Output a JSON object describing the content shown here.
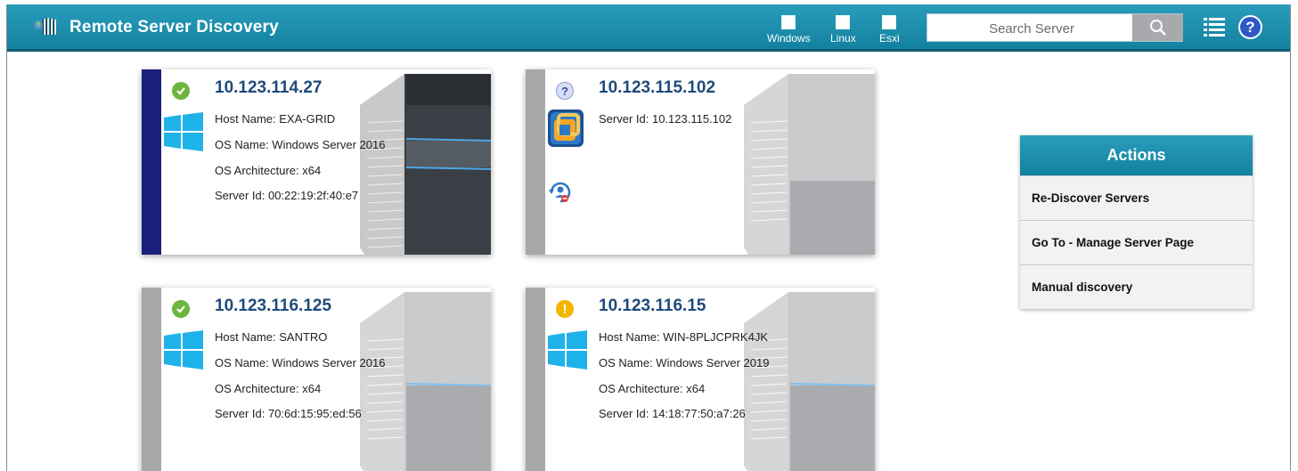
{
  "header": {
    "title": "Remote Server Discovery",
    "filters": [
      "Windows",
      "Linux",
      "Esxi"
    ],
    "search_placeholder": "Search Server"
  },
  "servers": [
    {
      "ip": "10.123.114.27",
      "status": "ok",
      "os_icon": "windows-logo-icon",
      "lines": [
        "Host Name: EXA-GRID",
        "OS Name: Windows Server 2016",
        "OS Architecture: x64",
        "Server Id: 00:22:19:2f:40:e7"
      ]
    },
    {
      "ip": "10.123.115.102",
      "status": "unknown",
      "os_icon": "vmware-logo-icon",
      "lines": [
        "Server Id: 10.123.115.102"
      ]
    },
    {
      "ip": "10.123.116.125",
      "status": "ok",
      "os_icon": "windows-logo-icon",
      "lines": [
        "Host Name: SANTRO",
        "OS Name: Windows Server 2016",
        "OS Architecture: x64",
        "Server Id: 70:6d:15:95:ed:56"
      ]
    },
    {
      "ip": "10.123.116.15",
      "status": "warning",
      "os_icon": "windows-logo-icon",
      "lines": [
        "Host Name: WIN-8PLJCPRK4JK",
        "OS Name: Windows Server 2019",
        "OS Architecture: x64",
        "Server Id: 14:18:77:50:a7:26"
      ]
    }
  ],
  "actions": {
    "title": "Actions",
    "items": [
      "Re-Discover Servers",
      "Go To - Manage Server Page",
      "Manual discovery"
    ]
  },
  "colors": {
    "header": "#1a8fae",
    "selected_bar": "#19207a",
    "ip_text": "#1f4b7a"
  }
}
